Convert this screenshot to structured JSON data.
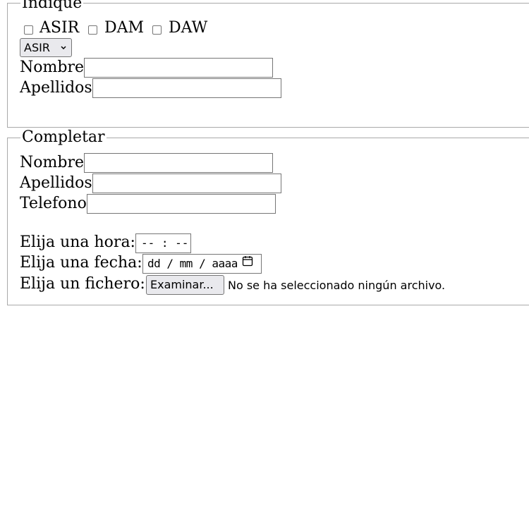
{
  "indique": {
    "legend": "Indique",
    "checkboxes": [
      {
        "label": "ASIR",
        "checked": false
      },
      {
        "label": "DAM",
        "checked": false
      },
      {
        "label": "DAW",
        "checked": false
      }
    ],
    "select_value": "ASIR",
    "nombre_label": "Nombre",
    "apellidos_label": "Apellidos"
  },
  "completar": {
    "legend": "Completar",
    "nombre_label": "Nombre",
    "apellidos_label": "Apellidos",
    "telefono_label": "Telefono",
    "hora_label": "Elija una hora:",
    "hora_placeholder": "-- : --",
    "fecha_label": "Elija una fecha:",
    "fecha_placeholder": "dd / mm / aaaa",
    "fichero_label": "Elija un fichero:",
    "fichero_button": "Examinar...",
    "fichero_status": "No se ha seleccionado ningún archivo."
  },
  "icons": {
    "calendar": "calendar-icon",
    "chevron": "chevron-down-icon"
  }
}
